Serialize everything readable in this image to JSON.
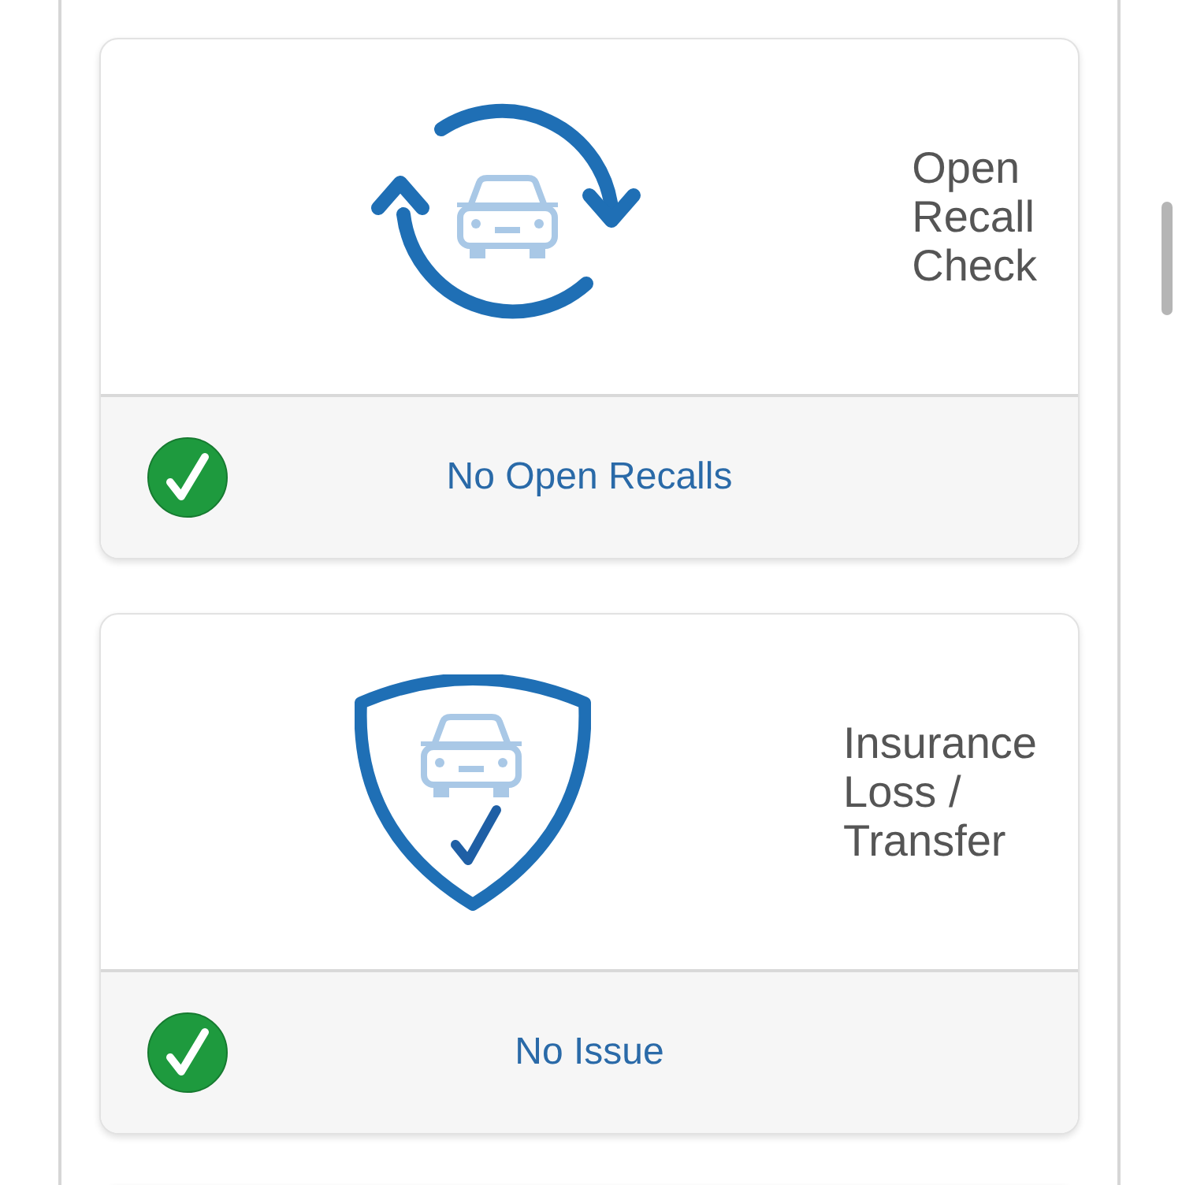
{
  "cards": [
    {
      "kind": "recall",
      "title_lines": [
        "Open",
        "Recall",
        "Check"
      ],
      "passed": true,
      "result": "No Open Recalls"
    },
    {
      "kind": "shield",
      "title_lines": [
        "Insurance",
        "Loss /",
        "Transfer"
      ],
      "passed": true,
      "result": "No Issue"
    }
  ]
}
